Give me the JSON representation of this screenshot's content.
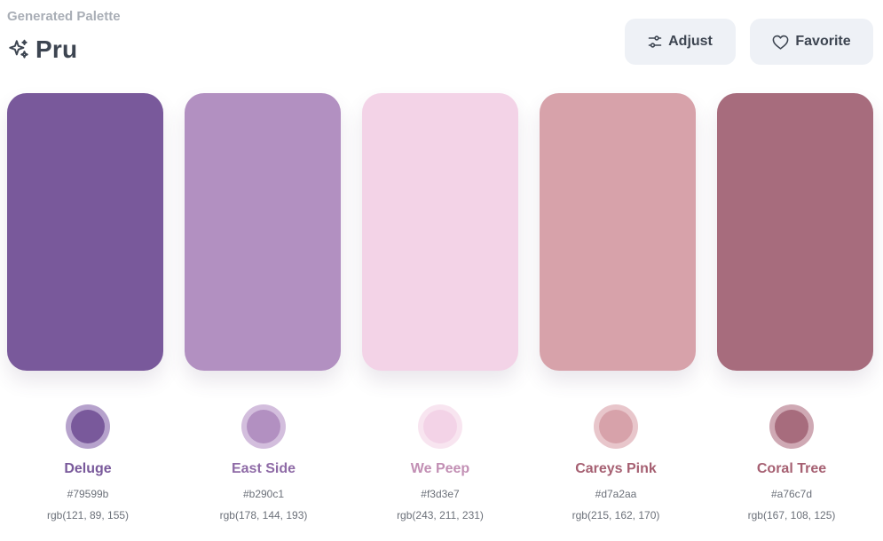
{
  "header": {
    "eyebrow": "Generated Palette",
    "title": "Pru",
    "icon": "sparkles-icon"
  },
  "actions": {
    "adjust_label": "Adjust",
    "adjust_icon": "sliders-icon",
    "favorite_label": "Favorite",
    "favorite_icon": "heart-icon"
  },
  "colors": [
    {
      "name": "Deluge",
      "hex": "#79599b",
      "rgb": "rgb(121, 89, 155)",
      "ring": "#b6a2cc",
      "label_color": "#79599b"
    },
    {
      "name": "East Side",
      "hex": "#b290c1",
      "rgb": "rgb(178, 144, 193)",
      "ring": "#d3bedd",
      "label_color": "#8e6aa6"
    },
    {
      "name": "We Peep",
      "hex": "#f3d3e7",
      "rgb": "rgb(243, 211, 231)",
      "ring": "#f8e5f0",
      "label_color": "#c28fb4"
    },
    {
      "name": "Careys Pink",
      "hex": "#d7a2aa",
      "rgb": "rgb(215, 162, 170)",
      "ring": "#e8c6cb",
      "label_color": "#a66072"
    },
    {
      "name": "Coral Tree",
      "hex": "#a76c7d",
      "rgb": "rgb(167, 108, 125)",
      "ring": "#cfa9b4",
      "label_color": "#a66072"
    }
  ]
}
